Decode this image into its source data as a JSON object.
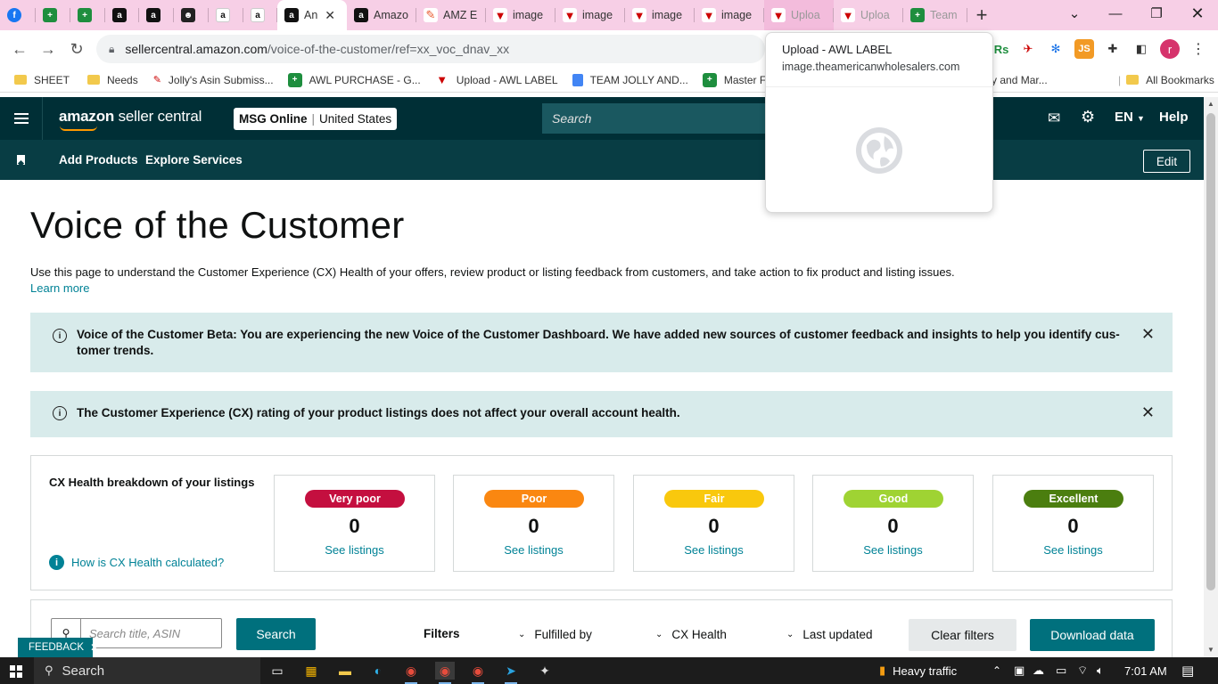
{
  "browser": {
    "tabs": [
      {
        "label": "",
        "icon": "facebook-icon"
      },
      {
        "label": "",
        "icon": "sheets-icon"
      },
      {
        "label": "",
        "icon": "sheets-icon"
      },
      {
        "label": "",
        "icon": "amazon-icon"
      },
      {
        "label": "",
        "icon": "amazon-icon"
      },
      {
        "label": "",
        "icon": "ghost-icon"
      },
      {
        "label": "",
        "icon": "amazon-smile-icon"
      },
      {
        "label": "",
        "icon": "amazon-smile-icon"
      },
      {
        "label": "An",
        "icon": "amazon-icon",
        "active": true
      },
      {
        "label": "Amazo",
        "icon": "amazon-icon"
      },
      {
        "label": "AMZ E",
        "icon": "zoho-icon"
      },
      {
        "label": "image",
        "icon": "awl-icon"
      },
      {
        "label": "image",
        "icon": "awl-icon"
      },
      {
        "label": "image",
        "icon": "awl-icon"
      },
      {
        "label": "image",
        "icon": "awl-icon"
      },
      {
        "label": "Uploa",
        "icon": "awl-icon"
      },
      {
        "label": "Uploa",
        "icon": "awl-icon"
      },
      {
        "label": "Team P",
        "icon": "sheets-icon"
      }
    ],
    "url_host": "sellercentral.amazon.com",
    "url_path": "/voice-of-the-customer/ref=xx_voc_dnav_xx",
    "bookmarks": [
      {
        "label": "SHEET",
        "icon": "folder-icon"
      },
      {
        "label": "Needs",
        "icon": "folder-icon"
      },
      {
        "label": "Jolly's Asin Submiss...",
        "icon": "jolly-icon"
      },
      {
        "label": "AWL PURCHASE - G...",
        "icon": "sheets-icon"
      },
      {
        "label": "Upload - AWL LABEL",
        "icon": "awl-icon"
      },
      {
        "label": "TEAM JOLLY AND...",
        "icon": "docs-icon"
      },
      {
        "label": "Master File di",
        "icon": "sheets-icon"
      },
      {
        "label": "olly and Mar...",
        "icon": ""
      }
    ],
    "all_bookmarks": "All Bookmarks",
    "hovercard": {
      "title": "Upload - AWL LABEL",
      "url": "image.theamericanwholesalers.com"
    },
    "profile_initial": "r"
  },
  "header": {
    "logo_main": "amazon",
    "logo_sub": "seller central",
    "account_name": "MSG Online",
    "account_region": "United States",
    "search_placeholder": "Search",
    "language": "EN",
    "help": "Help"
  },
  "subnav": {
    "add_products": "Add Products",
    "explore_services": "Explore Services",
    "edit": "Edit"
  },
  "page": {
    "title": "Voice of the Customer",
    "intro": "Use this page to understand the Customer Experience (CX) Health of your offers, review product or listing feedback from customers, and take action to fix product and listing issues.",
    "learn_more": "Learn more",
    "banner1": "Voice of the Customer Beta: You are experiencing the new Voice of the Customer Dashboard. We have added new sources of customer feedback and insights to help you identify cus- tomer trends.",
    "banner2": "The Customer Experience (CX) rating of your product listings does not affect your overall account health.",
    "cx_title": "CX Health breakdown of your listings",
    "cx_how": "How is CX Health calculated?",
    "cx_cards": [
      {
        "label": "Very poor",
        "count": "0",
        "link": "See listings",
        "color": "#c40f3f"
      },
      {
        "label": "Poor",
        "count": "0",
        "link": "See listings",
        "color": "#fa8711"
      },
      {
        "label": "Fair",
        "count": "0",
        "link": "See listings",
        "color": "#f9c80d"
      },
      {
        "label": "Good",
        "count": "0",
        "link": "See listings",
        "color": "#9fd333"
      },
      {
        "label": "Excellent",
        "count": "0",
        "link": "See listings",
        "color": "#4b7e0f"
      }
    ],
    "search_placeholder": "Search title, ASIN",
    "search_button": "Search",
    "filters_label": "Filters",
    "filter_fulfilled": "Fulfilled by",
    "filter_cx": "CX Health",
    "filter_updated": "Last updated",
    "clear_filters": "Clear filters",
    "download": "Download data",
    "feedback": "FEEDBACK"
  },
  "taskbar": {
    "search": "Search",
    "weather": "Heavy traffic",
    "time": "7:01 AM"
  },
  "colors": {
    "header_dark": "#002f36",
    "subnav": "#083d44",
    "teal_button": "#00707d",
    "banner_bg": "#d8ebeb",
    "link": "#008296"
  }
}
